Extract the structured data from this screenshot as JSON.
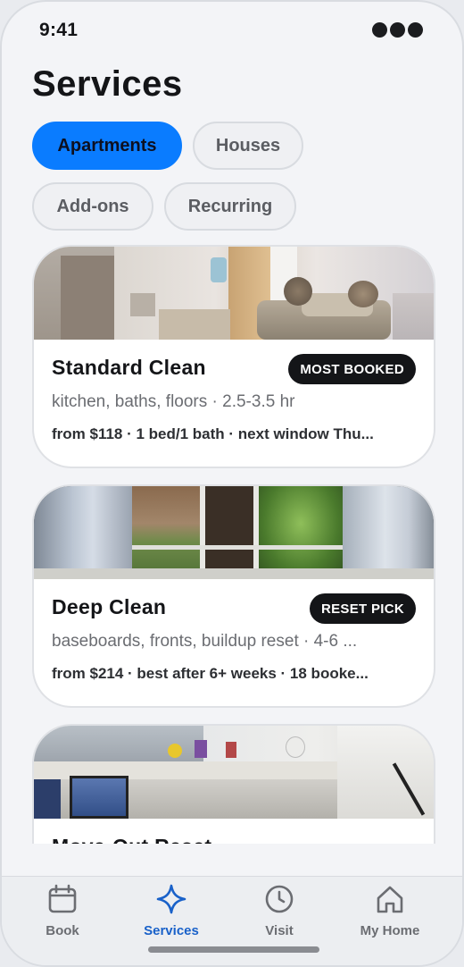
{
  "status_bar": {
    "time": "9:41",
    "icon": "signal-dots-icon"
  },
  "page": {
    "title": "Services"
  },
  "filters": [
    {
      "label": "Apartments",
      "selected": true
    },
    {
      "label": "Houses",
      "selected": false
    },
    {
      "label": "Add-ons",
      "selected": false
    },
    {
      "label": "Recurring",
      "selected": false
    }
  ],
  "cards": [
    {
      "title": "Standard Clean",
      "badge": "MOST BOOKED",
      "description": "kitchen, baths, floors · 2.5-3.5 hr",
      "meta": "from $118 · 1 bed/1 bath · next window Thu...",
      "image": "living-room-photo"
    },
    {
      "title": "Deep Clean",
      "badge": "RESET PICK",
      "description": "baseboards, fronts, buildup reset · 4-6 ...",
      "meta": "from $214 · best after 6+ weeks · 18 booke...",
      "image": "window-curtains-photo"
    },
    {
      "title": "Move-Out Reset",
      "badge": "",
      "description": "",
      "meta": "",
      "image": "office-desk-photo"
    }
  ],
  "tabs": [
    {
      "label": "Book",
      "icon": "calendar-icon",
      "active": false
    },
    {
      "label": "Services",
      "icon": "sparkle-icon",
      "active": true
    },
    {
      "label": "Visit",
      "icon": "clock-icon",
      "active": false
    },
    {
      "label": "My Home",
      "icon": "home-icon",
      "active": false
    }
  ],
  "colors": {
    "accent": "#0a7cff",
    "active_tab": "#1961c9",
    "badge_bg": "#141518",
    "background": "#f3f4f7"
  }
}
